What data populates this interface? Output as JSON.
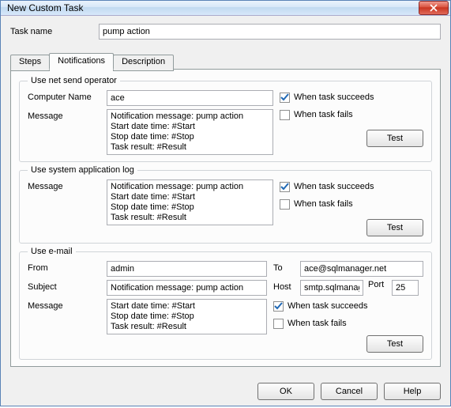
{
  "window": {
    "title": "New Custom Task"
  },
  "task": {
    "name_label": "Task name",
    "name_value": "pump action"
  },
  "tabs": {
    "steps": "Steps",
    "notifications": "Notifications",
    "description": "Description"
  },
  "netsend": {
    "legend": "Use net send operator",
    "computer_label": "Computer Name",
    "computer_value": "ace",
    "message_label": "Message",
    "message_value": "Notification message: pump action\nStart date time: #Start\nStop date time: #Stop\nTask result: #Result",
    "succeeds_label": "When task succeeds",
    "fails_label": "When task fails",
    "test_label": "Test"
  },
  "applog": {
    "legend": "Use system application log",
    "message_label": "Message",
    "message_value": "Notification message: pump action\nStart date time: #Start\nStop date time: #Stop\nTask result: #Result",
    "succeeds_label": "When task succeeds",
    "fails_label": "When task fails",
    "test_label": "Test"
  },
  "email": {
    "legend": "Use e-mail",
    "from_label": "From",
    "from_value": "admin",
    "to_label": "To",
    "to_value": "ace@sqlmanager.net",
    "subject_label": "Subject",
    "subject_value": "Notification message: pump action",
    "host_label": "Host",
    "host_value": "smtp.sqlmanager",
    "port_label": "Port",
    "port_value": "25",
    "message_label": "Message",
    "message_value": "Start date time: #Start\nStop date time: #Stop\nTask result: #Result",
    "succeeds_label": "When task succeeds",
    "fails_label": "When task fails",
    "test_label": "Test"
  },
  "footer": {
    "ok": "OK",
    "cancel": "Cancel",
    "help": "Help"
  }
}
